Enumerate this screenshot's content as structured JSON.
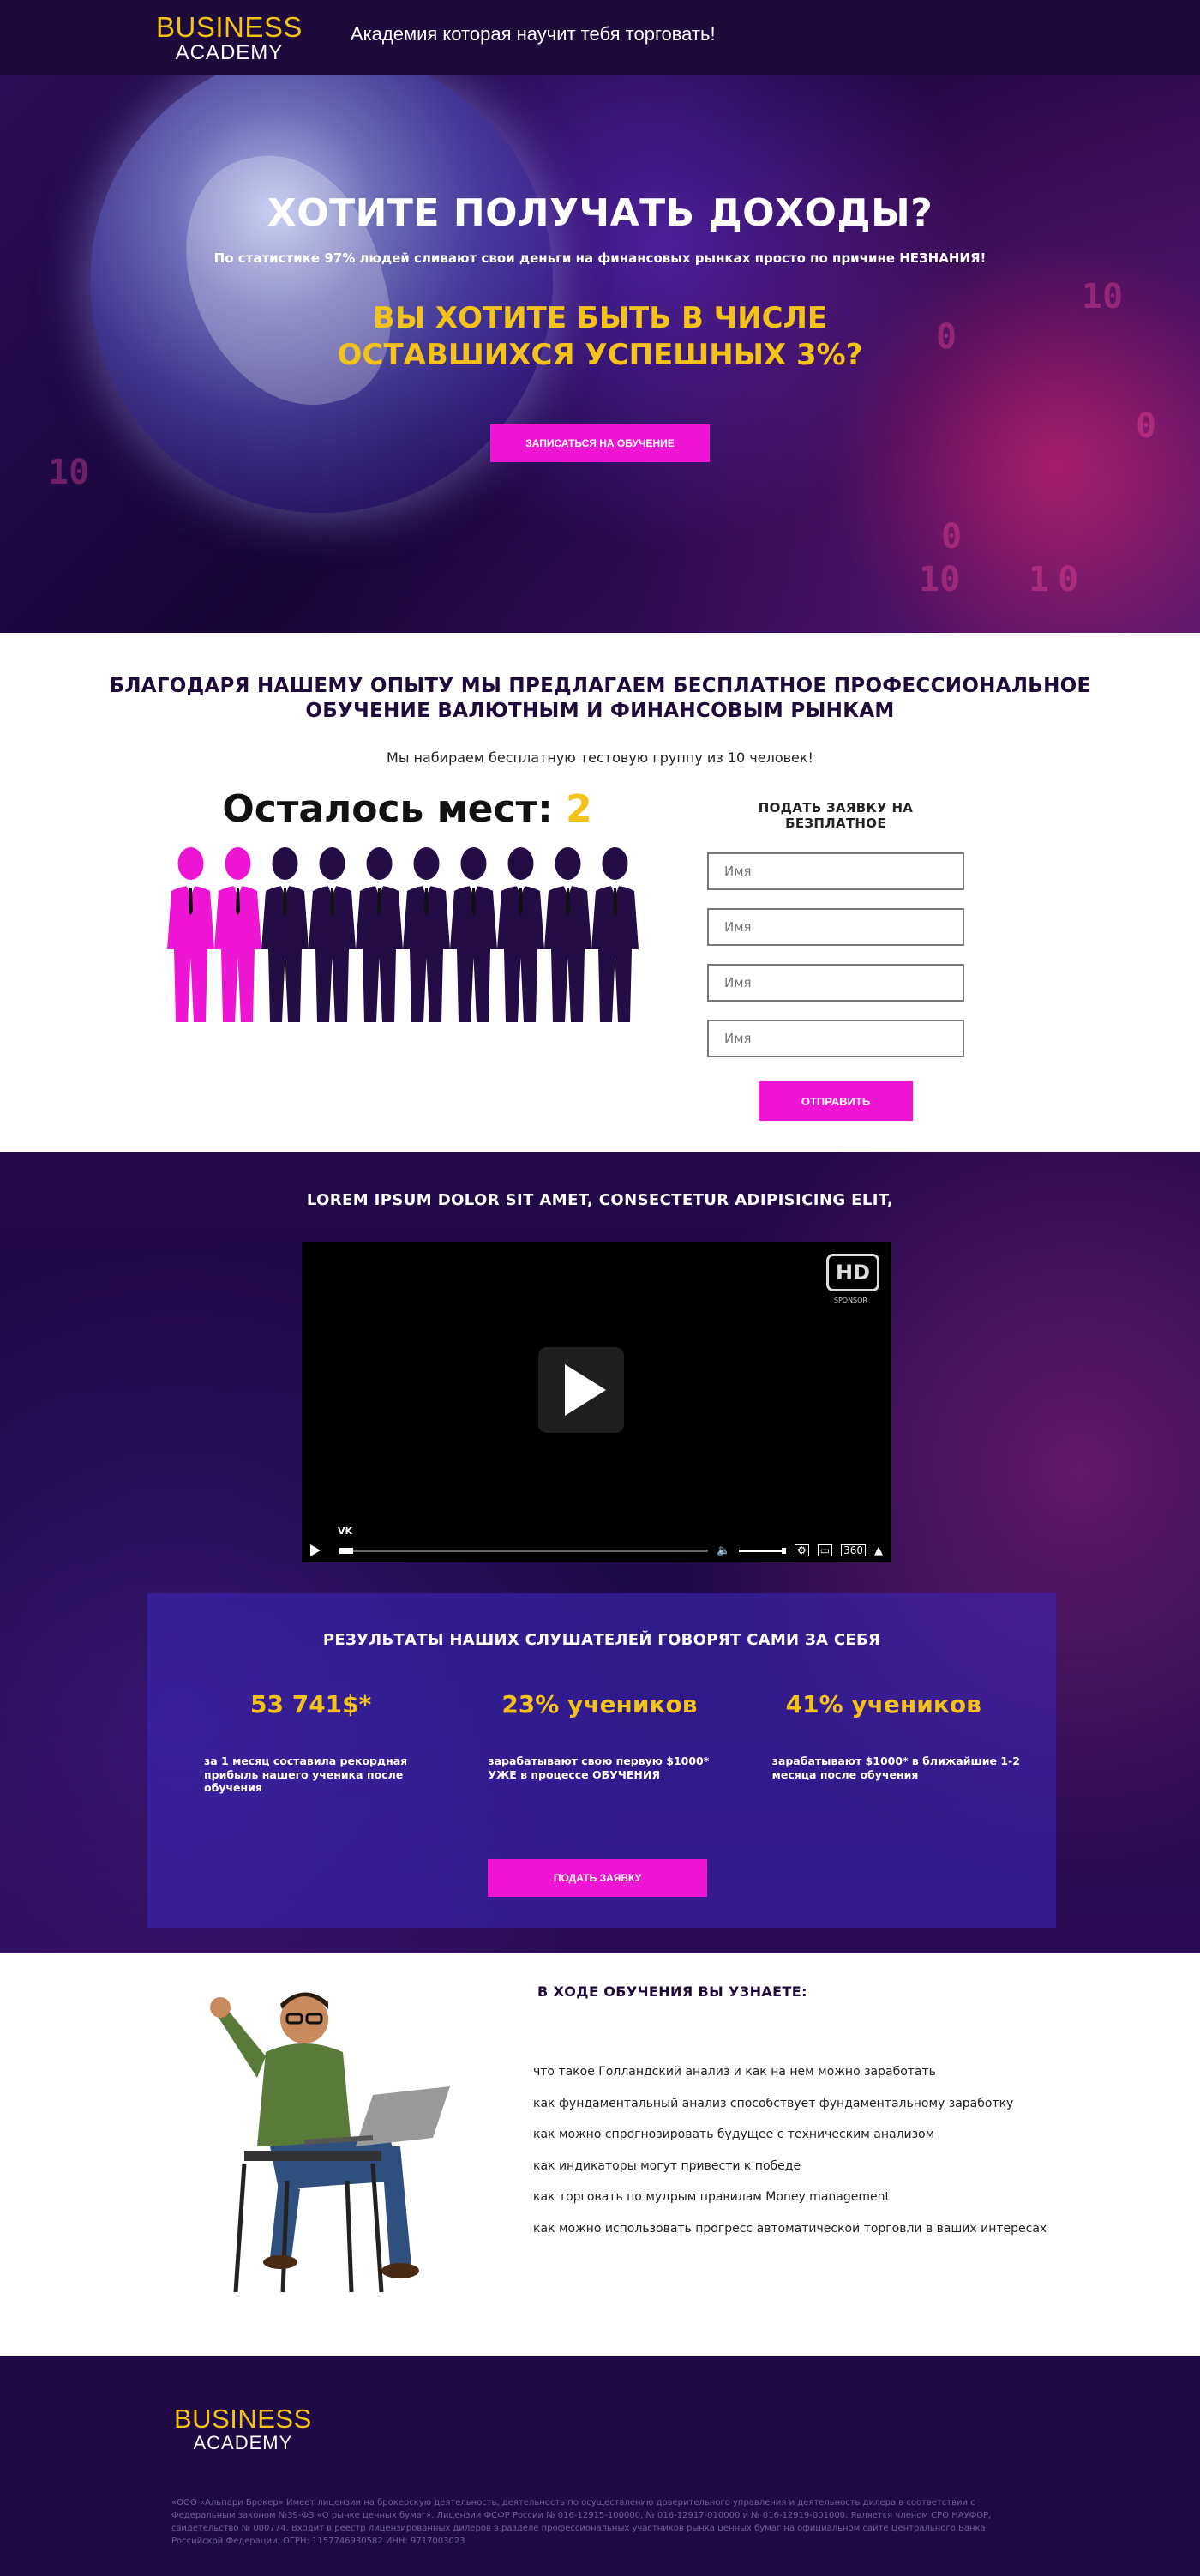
{
  "header": {
    "logo_top": "BUSINESS",
    "logo_bottom": "ACADEMY",
    "tagline": "Академия которая научит тебя торговать!"
  },
  "hero": {
    "title": "ХОТИТЕ ПОЛУЧАТЬ ДОХОДЫ?",
    "stat": "По статистике 97% людей сливают свои деньги на финансовых рынках просто по причине НЕЗНАНИЯ!",
    "subtitle": "ВЫ ХОТИТЕ БЫТЬ В ЧИСЛЕ ОСТАВШИХСЯ УСПЕШНЫХ 3%?",
    "cta": "ЗАПИСАТЬСЯ НА ОБУЧЕНИЕ",
    "bg_digits": [
      "10",
      "0",
      "10",
      "0",
      "0",
      "10",
      "1",
      "0"
    ]
  },
  "offer": {
    "title_line1": "БЛАГОДАРЯ НАШЕМУ ОПЫТУ МЫ ПРЕДЛАГАЕМ БЕСПЛАТНОЕ ПРОФЕССИОНАЛЬНОЕ",
    "title_line2": "ОБУЧЕНИЕ ВАЛЮТНЫМ И ФИНАНСОВЫМ РЫНКАМ",
    "subtitle": "Мы набираем бесплатную тестовую группу из 10 человек!",
    "seats_label": "Осталось мест:",
    "seats_left": "2",
    "seats_total": 10,
    "free_color": "#ee16d4",
    "taken_color": "#240c45"
  },
  "form": {
    "title": "ПОДАТЬ ЗАЯВКУ НА БЕЗПЛАТНОЕ",
    "fields": [
      {
        "placeholder": "Имя"
      },
      {
        "placeholder": "Имя"
      },
      {
        "placeholder": "Имя"
      },
      {
        "placeholder": "Имя"
      }
    ],
    "submit": "ОТПРАВИТЬ"
  },
  "video": {
    "title": "LOREM IPSUM DOLOR SIT AMET, CONSECTETUR ADIPISICING ELIT,",
    "badge": "HD",
    "sponsor": "SPONSOR",
    "brand": "VK",
    "volume_icon": "speaker-icon",
    "controls_icons": [
      "play-icon",
      "speaker-icon",
      "settings-icon",
      "window-icon",
      "resolution-icon",
      "expand-icon"
    ]
  },
  "results": {
    "title": "РЕЗУЛЬТАТЫ НАШИХ СЛУШАТЕЛЕЙ ГОВОРЯТ САМИ ЗА СЕБЯ",
    "items": [
      {
        "value": "53 741$*",
        "text": "за 1 месяц составила рекордная прибыль нашего ученика после обучения"
      },
      {
        "value": "23% учеников",
        "text": "зарабатывают свою первую $1000* УЖЕ в процессе ОБУЧЕНИЯ"
      },
      {
        "value": "41% учеников",
        "text": "зарабатывают $1000* в ближайшие 1-2 месяца после обучения"
      }
    ],
    "cta": "ПОДАТЬ ЗАЯВКУ"
  },
  "learn": {
    "title": "В ХОДЕ ОБУЧЕНИЯ ВЫ УЗНАЕТЕ:",
    "items": [
      "что такое Голландский анализ и как на нем можно заработать",
      "как фундаментальный анализ способствует фундаментальному заработку",
      "как можно спрогнозировать будущее с техническим анализом",
      "как индикаторы могут привести к победе",
      "как торговать по мудрым правилам Money management",
      "как можно использовать прогресс автоматической торговли в ваших интересах"
    ]
  },
  "footer": {
    "logo_top": "BUSINESS",
    "logo_bottom": "ACADEMY",
    "legal": "«ООО «Альпари Брокер» Имеет лицензии на брокерскую деятельность, деятельность по осуществлению доверительного управления и деятельность дилера в соответствии с Федеральным законом №39-ФЗ «О рынке ценных бумаг». Лицензии ФСФР России № 016-12915-100000, № 016-12917-010000 и № 016-12919-001000. Является членом СРО НАУФОР, свидетельство № 000774. Входит в реестр лицензированных дилеров в разделе профессиональных участников рынка ценных бумаг на официальном сайте Центрального Банка Российской Федерации. ОГРН: 1157746930582 ИНН: 9717003023"
  },
  "colors": {
    "accent": "#ee16d4",
    "gold": "#f3c319",
    "dark": "#1e0b3c"
  }
}
